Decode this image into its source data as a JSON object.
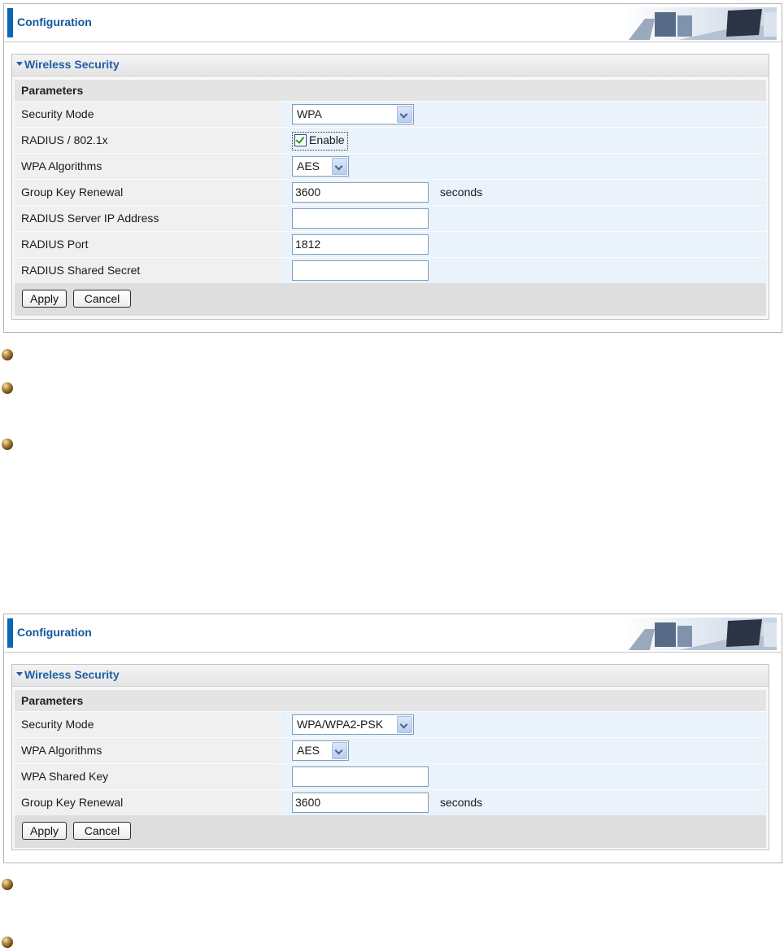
{
  "panels": [
    {
      "header_title": "Configuration",
      "section_title": "Wireless Security",
      "params_title": "Parameters",
      "rows": {
        "security_mode": {
          "label": "Security Mode",
          "value": "WPA"
        },
        "radius_8021x": {
          "label": "RADIUS / 802.1x",
          "checkbox_label": "Enable",
          "checked": true
        },
        "wpa_algorithms": {
          "label": "WPA Algorithms",
          "value": "AES"
        },
        "group_key_renewal": {
          "label": "Group Key Renewal",
          "value": "3600",
          "unit": "seconds"
        },
        "radius_server_ip": {
          "label": "RADIUS Server IP Address",
          "value": ""
        },
        "radius_port": {
          "label": "RADIUS Port",
          "value": "1812"
        },
        "radius_shared_secret": {
          "label": "RADIUS Shared Secret",
          "value": ""
        }
      },
      "buttons": {
        "apply": "Apply",
        "cancel": "Cancel"
      }
    },
    {
      "header_title": "Configuration",
      "section_title": "Wireless Security",
      "params_title": "Parameters",
      "rows": {
        "security_mode": {
          "label": "Security Mode",
          "value": "WPA/WPA2-PSK"
        },
        "wpa_algorithms": {
          "label": "WPA Algorithms",
          "value": "AES"
        },
        "wpa_shared_key": {
          "label": "WPA Shared Key",
          "value": ""
        },
        "group_key_renewal": {
          "label": "Group Key Renewal",
          "value": "3600",
          "unit": "seconds"
        }
      },
      "buttons": {
        "apply": "Apply",
        "cancel": "Cancel"
      }
    }
  ],
  "icons": {
    "bullet": "bronze-bullet-icon",
    "dropdown": "chevron-down-icon",
    "checkbox": "checkmark-icon",
    "header_art": "office-scene-banner-icon"
  },
  "colors": {
    "accent": "#0b66b3",
    "section_title": "#1f5fa6",
    "value_cell": "#eaf2fb",
    "label_cell": "#f0f0f0"
  }
}
